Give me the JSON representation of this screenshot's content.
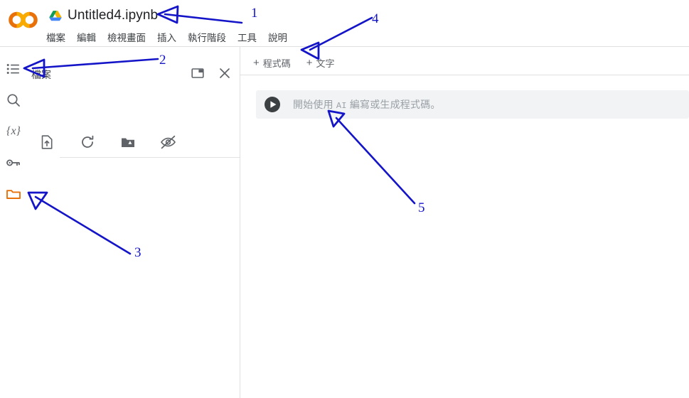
{
  "app": {
    "logo_text": "CO",
    "accent_orange": "#e8710a",
    "annotation_color": "#1414c8"
  },
  "titlebar": {
    "drive_icon": "google-drive-icon",
    "notebook_name": "Untitled4.ipynb"
  },
  "menubar": {
    "items": [
      {
        "label": "檔案",
        "name": "menu-file"
      },
      {
        "label": "編輯",
        "name": "menu-edit"
      },
      {
        "label": "檢視畫面",
        "name": "menu-view"
      },
      {
        "label": "插入",
        "name": "menu-insert"
      },
      {
        "label": "執行階段",
        "name": "menu-runtime"
      },
      {
        "label": "工具",
        "name": "menu-tools"
      },
      {
        "label": "說明",
        "name": "menu-help"
      }
    ]
  },
  "left_rail": {
    "items": [
      {
        "name": "table-of-contents-icon",
        "label": "目錄",
        "active": false
      },
      {
        "name": "search-icon",
        "label": "搜尋",
        "active": false
      },
      {
        "name": "variables-icon",
        "label": "{x}",
        "active": false
      },
      {
        "name": "secrets-key-icon",
        "label": "密鑰",
        "active": false
      },
      {
        "name": "files-folder-icon",
        "label": "檔案",
        "active": true
      }
    ]
  },
  "file_panel": {
    "title": "檔案",
    "header_icons": [
      {
        "name": "collapse-panel-icon",
        "label": "收合面板"
      },
      {
        "name": "close-panel-icon",
        "label": "關閉"
      }
    ],
    "toolbar": [
      {
        "name": "upload-file-icon",
        "label": "上傳檔案"
      },
      {
        "name": "refresh-icon",
        "label": "重新整理"
      },
      {
        "name": "mount-drive-icon",
        "label": "掛接雲端硬碟"
      },
      {
        "name": "toggle-hidden-icon",
        "label": "顯示/隱藏隱藏檔"
      }
    ]
  },
  "notebook": {
    "add_buttons": [
      {
        "name": "add-code-cell-button",
        "plus": "+",
        "label": "程式碼"
      },
      {
        "name": "add-text-cell-button",
        "plus": "+",
        "label": "文字"
      }
    ],
    "cell": {
      "run_icon": "run-cell-icon",
      "placeholder_pre": "開始使用",
      "placeholder_mono": "AI",
      "placeholder_post": "編寫或生成程式碼。"
    }
  },
  "annotations": [
    {
      "id": "1",
      "label": "1",
      "target": "notebook-title"
    },
    {
      "id": "2",
      "label": "2",
      "target": "file-panel-title"
    },
    {
      "id": "3",
      "label": "3",
      "target": "files-folder-icon"
    },
    {
      "id": "4",
      "label": "4",
      "target": "add-code-cell-button"
    },
    {
      "id": "5",
      "label": "5",
      "target": "code-cell-input"
    }
  ]
}
